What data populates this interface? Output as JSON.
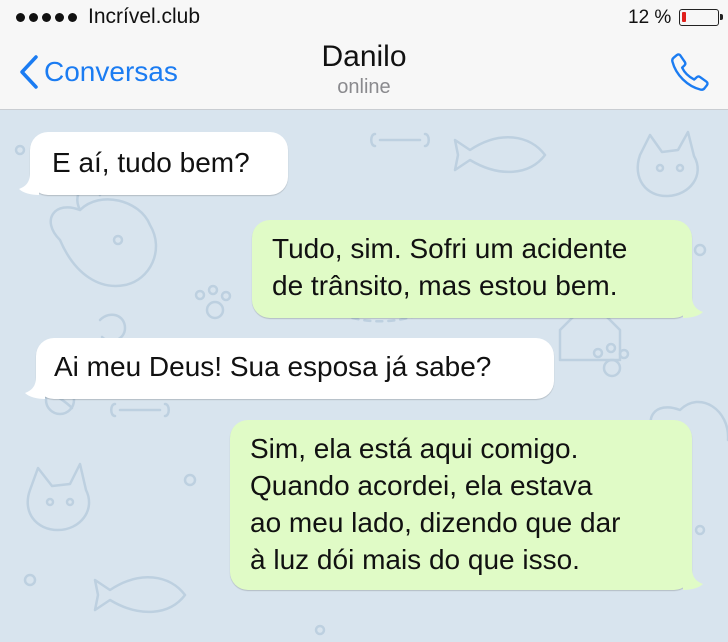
{
  "status_bar": {
    "carrier": "Incrível.club",
    "signal_bars": 5,
    "battery_text": "12 %",
    "battery_level": 0.12,
    "battery_color": "#e0201c"
  },
  "nav": {
    "back_label": "Conversas",
    "back_icon": "chevron-left-icon",
    "contact_name": "Danilo",
    "contact_status": "online",
    "call_icon": "phone-icon",
    "accent_color": "#1b7cf2"
  },
  "chat": {
    "wallpaper": "cat-and-dog-doodle-pattern",
    "incoming_color": "#ffffff",
    "outgoing_color": "#e0fbc6",
    "messages": [
      {
        "direction": "incoming",
        "lines": [
          "E aí, tudo bem?"
        ]
      },
      {
        "direction": "outgoing",
        "lines": [
          "Tudo, sim. Sofri um acidente",
          "de trânsito, mas estou bem."
        ]
      },
      {
        "direction": "incoming",
        "lines": [
          "Ai meu Deus! Sua esposa já sabe?"
        ]
      },
      {
        "direction": "outgoing",
        "lines": [
          "Sim, ela está aqui comigo.",
          "Quando acordei, ela estava",
          "ao meu lado, dizendo que dar",
          "à luz dói mais do que isso."
        ]
      }
    ]
  }
}
